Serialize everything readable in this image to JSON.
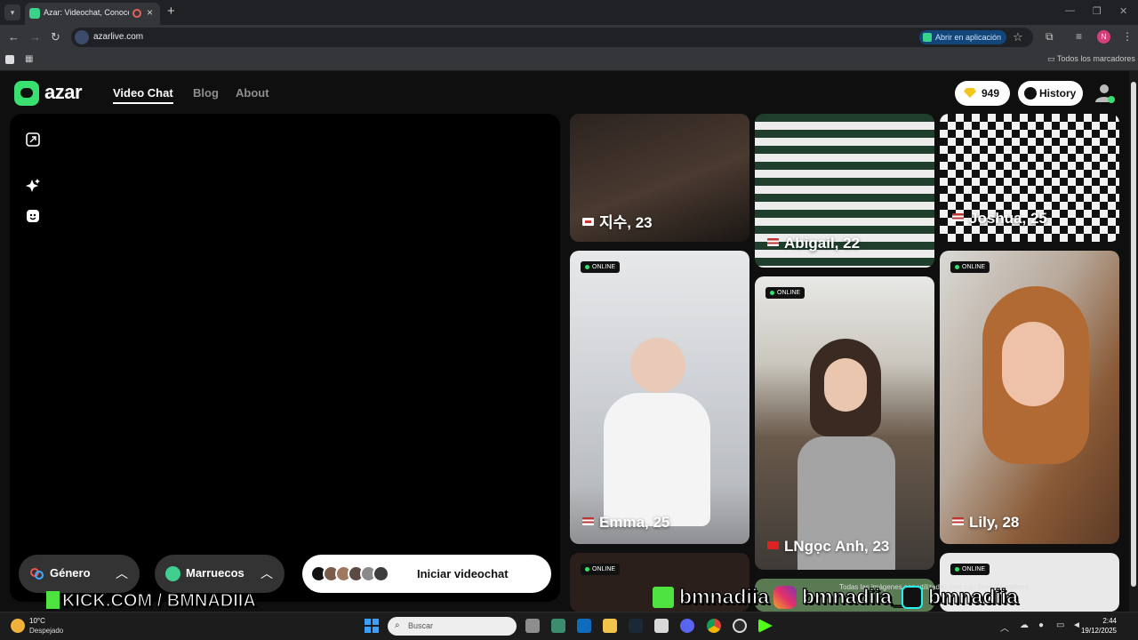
{
  "browser": {
    "tab_title": "Azar: Videochat, Conoce Ar",
    "new_tab": "+",
    "url": "azarlive.com",
    "open_in_app": "Abrir en aplicación",
    "profile_initial": "N",
    "all_bookmarks": "Todos los marcadores"
  },
  "header": {
    "logo_text": "azar",
    "nav": [
      "Video Chat",
      "Blog",
      "About"
    ],
    "coins": "949",
    "history_label": "History"
  },
  "controls": {
    "gender_label": "Género",
    "country_label": "Marruecos",
    "start_label": "Iniciar videochat"
  },
  "profiles": [
    {
      "name": "지수, 23",
      "country": "KR",
      "online": false
    },
    {
      "name": "Abigail, 22",
      "country": "US",
      "online": false
    },
    {
      "name": "Joshua, 25",
      "country": "US",
      "online": false
    },
    {
      "name": "Emma, 25",
      "country": "US",
      "online": true
    },
    {
      "name": "LNgọc Anh, 23",
      "country": "VN",
      "online": true
    },
    {
      "name": "Lily, 28",
      "country": "US",
      "online": true
    },
    {
      "name": "",
      "country": "",
      "online": true
    },
    {
      "name": "",
      "country": "",
      "online": true
    }
  ],
  "online_badge": "ONLINE",
  "disclaimer": "Todas las imágenes son utilizadas solo con fines ilustrativos.",
  "overlays": {
    "kick": "KICK.COM / BMNADIIA",
    "kick_handle": "bmnadiia",
    "instagram_handle": "bmnadiia_",
    "tiktok_handle": "bmnadiia"
  },
  "taskbar": {
    "temperature": "10°C",
    "weather": "Despejado",
    "search_placeholder": "Buscar",
    "time": "2:44",
    "date": "19/12/2025"
  },
  "colors": {
    "brand_green": "#39e06f",
    "online_dot": "#39e06f",
    "coin_gold": "#f4c51b"
  }
}
